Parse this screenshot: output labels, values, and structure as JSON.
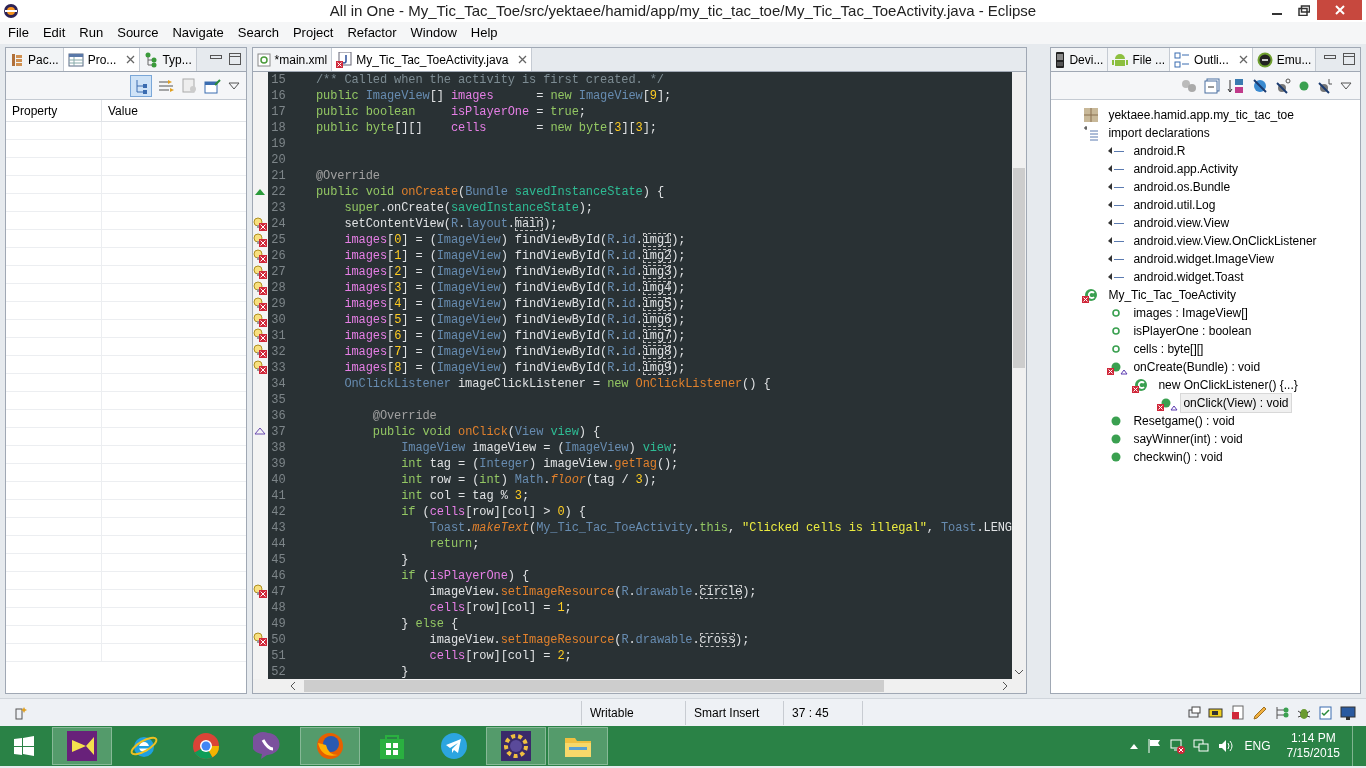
{
  "window": {
    "title": "All in One - My_Tic_Tac_Toe/src/yektaee/hamid/app/my_tic_tac_toe/My_Tic_Tac_ToeActivity.java - Eclipse"
  },
  "menu": [
    "File",
    "Edit",
    "Run",
    "Source",
    "Navigate",
    "Search",
    "Project",
    "Refactor",
    "Window",
    "Help"
  ],
  "left_panel": {
    "tabs": [
      {
        "label": "Pac...",
        "kind": "package",
        "selected": false
      },
      {
        "label": "Pro...",
        "kind": "properties",
        "selected": true
      },
      {
        "label": "Typ...",
        "kind": "hierarchy",
        "selected": false
      }
    ],
    "columns": [
      "Property",
      "Value"
    ]
  },
  "editor": {
    "tabs": [
      {
        "label": "*main.xml",
        "kind": "xml",
        "selected": false
      },
      {
        "label": "My_Tic_Tac_ToeActivity.java",
        "kind": "java",
        "selected": true
      }
    ],
    "lines": [
      {
        "number": "15",
        "kind": "plain",
        "tokens": [
          {
            "kind": "comment",
            "text": "    /** Called when the activity is first created. */"
          }
        ]
      },
      {
        "number": "16",
        "kind": "plain",
        "tokens": [
          {
            "kind": "kw",
            "text": "    public "
          },
          {
            "kind": "type",
            "text": "ImageView"
          },
          {
            "kind": "plain",
            "text": "[] "
          },
          {
            "kind": "field",
            "text": "images"
          },
          {
            "kind": "plain",
            "text": "      = "
          },
          {
            "kind": "kw",
            "text": "new "
          },
          {
            "kind": "type",
            "text": "ImageView"
          },
          {
            "kind": "plain",
            "text": "["
          },
          {
            "kind": "num",
            "text": "9"
          },
          {
            "kind": "plain",
            "text": "];"
          }
        ]
      },
      {
        "number": "17",
        "kind": "plain",
        "tokens": [
          {
            "kind": "kw",
            "text": "    public boolean     "
          },
          {
            "kind": "field",
            "text": "isPlayerOne"
          },
          {
            "kind": "plain",
            "text": " = "
          },
          {
            "kind": "kw",
            "text": "true"
          },
          {
            "kind": "plain",
            "text": ";"
          }
        ]
      },
      {
        "number": "18",
        "kind": "plain",
        "tokens": [
          {
            "kind": "kw",
            "text": "    public byte"
          },
          {
            "kind": "plain",
            "text": "[][]    "
          },
          {
            "kind": "field",
            "text": "cells"
          },
          {
            "kind": "plain",
            "text": "       = "
          },
          {
            "kind": "kw",
            "text": "new byte"
          },
          {
            "kind": "plain",
            "text": "["
          },
          {
            "kind": "num",
            "text": "3"
          },
          {
            "kind": "plain",
            "text": "]["
          },
          {
            "kind": "num",
            "text": "3"
          },
          {
            "kind": "plain",
            "text": "];"
          }
        ]
      },
      {
        "number": "19",
        "kind": "plain"
      },
      {
        "number": "20",
        "kind": "plain"
      },
      {
        "number": "21",
        "kind": "plain",
        "tokens": [
          {
            "kind": "ann",
            "text": "    @Override"
          }
        ]
      },
      {
        "number": "22",
        "kind": "override",
        "tokens": [
          {
            "kind": "kw",
            "text": "    public void "
          },
          {
            "kind": "decl",
            "text": "onCreate"
          },
          {
            "kind": "plain",
            "text": "("
          },
          {
            "kind": "type",
            "text": "Bundle "
          },
          {
            "kind": "param",
            "text": "savedInstanceState"
          },
          {
            "kind": "plain",
            "text": ") {"
          }
        ]
      },
      {
        "number": "23",
        "kind": "plain",
        "tokens": [
          {
            "kind": "kw",
            "text": "        super"
          },
          {
            "kind": "plain",
            "text": ".onCreate("
          },
          {
            "kind": "param",
            "text": "savedInstanceState"
          },
          {
            "kind": "plain",
            "text": ");"
          }
        ]
      },
      {
        "number": "24",
        "kind": "error",
        "tokens": [
          {
            "kind": "plain",
            "text": "        setContentView("
          },
          {
            "kind": "type",
            "text": "R"
          },
          {
            "kind": "plain",
            "text": "."
          },
          {
            "kind": "type",
            "text": "layout"
          },
          {
            "kind": "plain",
            "text": "."
          },
          {
            "kind": "boxed",
            "text": "main"
          },
          {
            "kind": "plain",
            "text": ");"
          }
        ]
      },
      {
        "number": "25",
        "kind": "error",
        "tokens": [
          {
            "kind": "field",
            "text": "        images"
          },
          {
            "kind": "plain",
            "text": "["
          },
          {
            "kind": "num",
            "text": "0"
          },
          {
            "kind": "plain",
            "text": "] = ("
          },
          {
            "kind": "type",
            "text": "ImageView"
          },
          {
            "kind": "plain",
            "text": ") findViewById("
          },
          {
            "kind": "type",
            "text": "R"
          },
          {
            "kind": "plain",
            "text": "."
          },
          {
            "kind": "type",
            "text": "id"
          },
          {
            "kind": "plain",
            "text": "."
          },
          {
            "kind": "boxed",
            "text": "img1"
          },
          {
            "kind": "plain",
            "text": ");"
          }
        ]
      },
      {
        "number": "26",
        "kind": "error",
        "tokens": [
          {
            "kind": "field",
            "text": "        images"
          },
          {
            "kind": "plain",
            "text": "["
          },
          {
            "kind": "num",
            "text": "1"
          },
          {
            "kind": "plain",
            "text": "] = ("
          },
          {
            "kind": "type",
            "text": "ImageView"
          },
          {
            "kind": "plain",
            "text": ") findViewById("
          },
          {
            "kind": "type",
            "text": "R"
          },
          {
            "kind": "plain",
            "text": "."
          },
          {
            "kind": "type",
            "text": "id"
          },
          {
            "kind": "plain",
            "text": "."
          },
          {
            "kind": "boxed",
            "text": "img2"
          },
          {
            "kind": "plain",
            "text": ");"
          }
        ]
      },
      {
        "number": "27",
        "kind": "error",
        "tokens": [
          {
            "kind": "field",
            "text": "        images"
          },
          {
            "kind": "plain",
            "text": "["
          },
          {
            "kind": "num",
            "text": "2"
          },
          {
            "kind": "plain",
            "text": "] = ("
          },
          {
            "kind": "type",
            "text": "ImageView"
          },
          {
            "kind": "plain",
            "text": ") findViewById("
          },
          {
            "kind": "type",
            "text": "R"
          },
          {
            "kind": "plain",
            "text": "."
          },
          {
            "kind": "type",
            "text": "id"
          },
          {
            "kind": "plain",
            "text": "."
          },
          {
            "kind": "boxed",
            "text": "img3"
          },
          {
            "kind": "plain",
            "text": ");"
          }
        ]
      },
      {
        "number": "28",
        "kind": "error",
        "tokens": [
          {
            "kind": "field",
            "text": "        images"
          },
          {
            "kind": "plain",
            "text": "["
          },
          {
            "kind": "num",
            "text": "3"
          },
          {
            "kind": "plain",
            "text": "] = ("
          },
          {
            "kind": "type",
            "text": "ImageView"
          },
          {
            "kind": "plain",
            "text": ") findViewById("
          },
          {
            "kind": "type",
            "text": "R"
          },
          {
            "kind": "plain",
            "text": "."
          },
          {
            "kind": "type",
            "text": "id"
          },
          {
            "kind": "plain",
            "text": "."
          },
          {
            "kind": "boxed",
            "text": "img4"
          },
          {
            "kind": "plain",
            "text": ");"
          }
        ]
      },
      {
        "number": "29",
        "kind": "error",
        "tokens": [
          {
            "kind": "field",
            "text": "        images"
          },
          {
            "kind": "plain",
            "text": "["
          },
          {
            "kind": "num",
            "text": "4"
          },
          {
            "kind": "plain",
            "text": "] = ("
          },
          {
            "kind": "type",
            "text": "ImageView"
          },
          {
            "kind": "plain",
            "text": ") findViewById("
          },
          {
            "kind": "type",
            "text": "R"
          },
          {
            "kind": "plain",
            "text": "."
          },
          {
            "kind": "type",
            "text": "id"
          },
          {
            "kind": "plain",
            "text": "."
          },
          {
            "kind": "boxed",
            "text": "img5"
          },
          {
            "kind": "plain",
            "text": ");"
          }
        ]
      },
      {
        "number": "30",
        "kind": "error",
        "tokens": [
          {
            "kind": "field",
            "text": "        images"
          },
          {
            "kind": "plain",
            "text": "["
          },
          {
            "kind": "num",
            "text": "5"
          },
          {
            "kind": "plain",
            "text": "] = ("
          },
          {
            "kind": "type",
            "text": "ImageView"
          },
          {
            "kind": "plain",
            "text": ") findViewById("
          },
          {
            "kind": "type",
            "text": "R"
          },
          {
            "kind": "plain",
            "text": "."
          },
          {
            "kind": "type",
            "text": "id"
          },
          {
            "kind": "plain",
            "text": "."
          },
          {
            "kind": "boxed",
            "text": "img6"
          },
          {
            "kind": "plain",
            "text": ");"
          }
        ]
      },
      {
        "number": "31",
        "kind": "error",
        "tokens": [
          {
            "kind": "field",
            "text": "        images"
          },
          {
            "kind": "plain",
            "text": "["
          },
          {
            "kind": "num",
            "text": "6"
          },
          {
            "kind": "plain",
            "text": "] = ("
          },
          {
            "kind": "type",
            "text": "ImageView"
          },
          {
            "kind": "plain",
            "text": ") findViewById("
          },
          {
            "kind": "type",
            "text": "R"
          },
          {
            "kind": "plain",
            "text": "."
          },
          {
            "kind": "type",
            "text": "id"
          },
          {
            "kind": "plain",
            "text": "."
          },
          {
            "kind": "boxed",
            "text": "img7"
          },
          {
            "kind": "plain",
            "text": ");"
          }
        ]
      },
      {
        "number": "32",
        "kind": "error",
        "tokens": [
          {
            "kind": "field",
            "text": "        images"
          },
          {
            "kind": "plain",
            "text": "["
          },
          {
            "kind": "num",
            "text": "7"
          },
          {
            "kind": "plain",
            "text": "] = ("
          },
          {
            "kind": "type",
            "text": "ImageView"
          },
          {
            "kind": "plain",
            "text": ") findViewById("
          },
          {
            "kind": "type",
            "text": "R"
          },
          {
            "kind": "plain",
            "text": "."
          },
          {
            "kind": "type",
            "text": "id"
          },
          {
            "kind": "plain",
            "text": "."
          },
          {
            "kind": "boxed",
            "text": "img8"
          },
          {
            "kind": "plain",
            "text": ");"
          }
        ]
      },
      {
        "number": "33",
        "kind": "error",
        "tokens": [
          {
            "kind": "field",
            "text": "        images"
          },
          {
            "kind": "plain",
            "text": "["
          },
          {
            "kind": "num",
            "text": "8"
          },
          {
            "kind": "plain",
            "text": "] = ("
          },
          {
            "kind": "type",
            "text": "ImageView"
          },
          {
            "kind": "plain",
            "text": ") findViewById("
          },
          {
            "kind": "type",
            "text": "R"
          },
          {
            "kind": "plain",
            "text": "."
          },
          {
            "kind": "type",
            "text": "id"
          },
          {
            "kind": "plain",
            "text": "."
          },
          {
            "kind": "boxed",
            "text": "img9"
          },
          {
            "kind": "plain",
            "text": ");"
          }
        ]
      },
      {
        "number": "34",
        "kind": "plain",
        "tokens": [
          {
            "kind": "type",
            "text": "        OnClickListener"
          },
          {
            "kind": "plain",
            "text": " imageClickListener = "
          },
          {
            "kind": "kw",
            "text": "new "
          },
          {
            "kind": "decl",
            "text": "OnClickListener"
          },
          {
            "kind": "plain",
            "text": "() {"
          }
        ]
      },
      {
        "number": "35",
        "kind": "plain"
      },
      {
        "number": "36",
        "kind": "plain",
        "tokens": [
          {
            "kind": "ann",
            "text": "            @Override"
          }
        ]
      },
      {
        "number": "37",
        "kind": "implements",
        "tokens": [
          {
            "kind": "kw",
            "text": "            public void "
          },
          {
            "kind": "decl",
            "text": "onClick"
          },
          {
            "kind": "plain",
            "text": "("
          },
          {
            "kind": "type",
            "text": "View "
          },
          {
            "kind": "param",
            "text": "view"
          },
          {
            "kind": "plain",
            "text": ") {"
          }
        ]
      },
      {
        "number": "38",
        "kind": "plain",
        "tokens": [
          {
            "kind": "type",
            "text": "                ImageView"
          },
          {
            "kind": "plain",
            "text": " imageView = ("
          },
          {
            "kind": "type",
            "text": "ImageView"
          },
          {
            "kind": "plain",
            "text": ") "
          },
          {
            "kind": "param",
            "text": "view"
          },
          {
            "kind": "plain",
            "text": ";"
          }
        ]
      },
      {
        "number": "39",
        "kind": "plain",
        "tokens": [
          {
            "kind": "kw",
            "text": "                int "
          },
          {
            "kind": "plain",
            "text": "tag = ("
          },
          {
            "kind": "type",
            "text": "Integer"
          },
          {
            "kind": "plain",
            "text": ") imageView."
          },
          {
            "kind": "decl",
            "text": "getTag"
          },
          {
            "kind": "plain",
            "text": "();"
          }
        ]
      },
      {
        "number": "40",
        "kind": "plain",
        "tokens": [
          {
            "kind": "kw",
            "text": "                int "
          },
          {
            "kind": "plain",
            "text": "row = ("
          },
          {
            "kind": "kw",
            "text": "int"
          },
          {
            "kind": "plain",
            "text": ") "
          },
          {
            "kind": "type",
            "text": "Math"
          },
          {
            "kind": "plain",
            "text": "."
          },
          {
            "kind": "italic",
            "text": "floor"
          },
          {
            "kind": "plain",
            "text": "(tag / "
          },
          {
            "kind": "num",
            "text": "3"
          },
          {
            "kind": "plain",
            "text": ");"
          }
        ]
      },
      {
        "number": "41",
        "kind": "plain",
        "tokens": [
          {
            "kind": "kw",
            "text": "                int "
          },
          {
            "kind": "plain",
            "text": "col = tag % "
          },
          {
            "kind": "num",
            "text": "3"
          },
          {
            "kind": "plain",
            "text": ";"
          }
        ]
      },
      {
        "number": "42",
        "kind": "plain",
        "tokens": [
          {
            "kind": "kw",
            "text": "                if "
          },
          {
            "kind": "plain",
            "text": "("
          },
          {
            "kind": "field",
            "text": "cells"
          },
          {
            "kind": "plain",
            "text": "[row][col] > "
          },
          {
            "kind": "num",
            "text": "0"
          },
          {
            "kind": "plain",
            "text": ") {"
          }
        ]
      },
      {
        "number": "43",
        "kind": "plain",
        "tokens": [
          {
            "kind": "type",
            "text": "                    Toast"
          },
          {
            "kind": "plain",
            "text": "."
          },
          {
            "kind": "italic",
            "text": "makeText"
          },
          {
            "kind": "plain",
            "text": "("
          },
          {
            "kind": "type",
            "text": "My_Tic_Tac_ToeActivity"
          },
          {
            "kind": "plain",
            "text": "."
          },
          {
            "kind": "kw",
            "text": "this"
          },
          {
            "kind": "plain",
            "text": ", "
          },
          {
            "kind": "str",
            "text": "\"Clicked cells is illegal\""
          },
          {
            "kind": "plain",
            "text": ", "
          },
          {
            "kind": "type",
            "text": "Toast"
          },
          {
            "kind": "plain",
            "text": ".LENG"
          }
        ]
      },
      {
        "number": "44",
        "kind": "plain",
        "tokens": [
          {
            "kind": "kw",
            "text": "                    return"
          },
          {
            "kind": "plain",
            "text": ";"
          }
        ]
      },
      {
        "number": "45",
        "kind": "plain",
        "tokens": [
          {
            "kind": "plain",
            "text": "                }"
          }
        ]
      },
      {
        "number": "46",
        "kind": "plain",
        "tokens": [
          {
            "kind": "kw",
            "text": "                if "
          },
          {
            "kind": "plain",
            "text": "("
          },
          {
            "kind": "field",
            "text": "isPlayerOne"
          },
          {
            "kind": "plain",
            "text": ") {"
          }
        ]
      },
      {
        "number": "47",
        "kind": "error",
        "tokens": [
          {
            "kind": "plain",
            "text": "                    imageView."
          },
          {
            "kind": "decl",
            "text": "setImageResource"
          },
          {
            "kind": "plain",
            "text": "("
          },
          {
            "kind": "type",
            "text": "R"
          },
          {
            "kind": "plain",
            "text": "."
          },
          {
            "kind": "type",
            "text": "drawable"
          },
          {
            "kind": "plain",
            "text": "."
          },
          {
            "kind": "boxed",
            "text": "circle"
          },
          {
            "kind": "plain",
            "text": ");"
          }
        ]
      },
      {
        "number": "48",
        "kind": "plain",
        "tokens": [
          {
            "kind": "field",
            "text": "                    cells"
          },
          {
            "kind": "plain",
            "text": "[row][col] = "
          },
          {
            "kind": "num",
            "text": "1"
          },
          {
            "kind": "plain",
            "text": ";"
          }
        ]
      },
      {
        "number": "49",
        "kind": "plain",
        "tokens": [
          {
            "kind": "plain",
            "text": "                } "
          },
          {
            "kind": "kw",
            "text": "else "
          },
          {
            "kind": "plain",
            "text": "{"
          }
        ]
      },
      {
        "number": "50",
        "kind": "error",
        "tokens": [
          {
            "kind": "plain",
            "text": "                    imageView."
          },
          {
            "kind": "decl",
            "text": "setImageResource"
          },
          {
            "kind": "plain",
            "text": "("
          },
          {
            "kind": "type",
            "text": "R"
          },
          {
            "kind": "plain",
            "text": "."
          },
          {
            "kind": "type",
            "text": "drawable"
          },
          {
            "kind": "plain",
            "text": "."
          },
          {
            "kind": "boxed",
            "text": "cross"
          },
          {
            "kind": "plain",
            "text": ");"
          }
        ]
      },
      {
        "number": "51",
        "kind": "plain",
        "tokens": [
          {
            "kind": "field",
            "text": "                    cells"
          },
          {
            "kind": "plain",
            "text": "[row][col] = "
          },
          {
            "kind": "num",
            "text": "2"
          },
          {
            "kind": "plain",
            "text": ";"
          }
        ]
      },
      {
        "number": "52",
        "kind": "plain",
        "tokens": [
          {
            "kind": "plain",
            "text": "                }"
          }
        ]
      }
    ]
  },
  "right_panel": {
    "tabs": [
      {
        "label": "Devi...",
        "kind": "phone",
        "selected": false
      },
      {
        "label": "File ...",
        "kind": "android",
        "selected": false
      },
      {
        "label": "Outli...",
        "kind": "outline",
        "selected": true
      },
      {
        "label": "Emu...",
        "kind": "emulator",
        "selected": false
      }
    ],
    "outline": [
      {
        "label": "yektaee.hamid.app.my_tic_tac_toe",
        "kind": "package",
        "error": false,
        "override": false,
        "selected": false
      },
      {
        "label": "import declarations",
        "kind": "imports",
        "error": false,
        "override": false,
        "selected": false,
        "children": [
          {
            "label": "android.R",
            "kind": "import",
            "error": false,
            "override": false,
            "selected": false
          },
          {
            "label": "android.app.Activity",
            "kind": "import",
            "error": false,
            "override": false,
            "selected": false
          },
          {
            "label": "android.os.Bundle",
            "kind": "import",
            "error": false,
            "override": false,
            "selected": false
          },
          {
            "label": "android.util.Log",
            "kind": "import",
            "error": false,
            "override": false,
            "selected": false
          },
          {
            "label": "android.view.View",
            "kind": "import",
            "error": false,
            "override": false,
            "selected": false
          },
          {
            "label": "android.view.View.OnClickListener",
            "kind": "import",
            "error": false,
            "override": false,
            "selected": false
          },
          {
            "label": "android.widget.ImageView",
            "kind": "import",
            "error": false,
            "override": false,
            "selected": false
          },
          {
            "label": "android.widget.Toast",
            "kind": "import",
            "error": false,
            "override": false,
            "selected": false
          }
        ]
      },
      {
        "label": "My_Tic_Tac_ToeActivity",
        "kind": "class",
        "error": true,
        "override": false,
        "selected": false,
        "children": [
          {
            "label": "images : ImageView[]",
            "kind": "field",
            "error": false,
            "override": false,
            "selected": false
          },
          {
            "label": "isPlayerOne : boolean",
            "kind": "field",
            "error": false,
            "override": false,
            "selected": false
          },
          {
            "label": "cells : byte[][]",
            "kind": "field",
            "error": false,
            "override": false,
            "selected": false
          },
          {
            "label": "onCreate(Bundle) : void",
            "kind": "method",
            "error": true,
            "override": true,
            "selected": false,
            "children": [
              {
                "label": "new OnClickListener() {...}",
                "kind": "class",
                "error": true,
                "override": false,
                "selected": false,
                "children": [
                  {
                    "label": "onClick(View) : void",
                    "kind": "method",
                    "error": true,
                    "override": true,
                    "selected": true
                  }
                ]
              }
            ]
          },
          {
            "label": "Resetgame() : void",
            "kind": "method",
            "error": false,
            "override": false,
            "selected": false
          },
          {
            "label": "sayWinner(int) : void",
            "kind": "method",
            "error": false,
            "override": false,
            "selected": false
          },
          {
            "label": "checkwin() : void",
            "kind": "method",
            "error": false,
            "override": false,
            "selected": false
          }
        ]
      }
    ]
  },
  "status_bar": [
    "Writable",
    "Smart Insert",
    "37 : 45"
  ],
  "taskbar": {
    "apps": [
      {
        "kind": "visualstudio",
        "running": true
      },
      {
        "kind": "ie",
        "running": false
      },
      {
        "kind": "chrome",
        "running": false
      },
      {
        "kind": "viber",
        "running": false
      },
      {
        "kind": "firefox",
        "running": true
      },
      {
        "kind": "store",
        "running": false
      },
      {
        "kind": "telegram",
        "running": false
      },
      {
        "kind": "eclipse",
        "running": true
      },
      {
        "kind": "explorer",
        "running": true
      }
    ],
    "language": "ENG",
    "time": "1:14 PM",
    "date": "7/15/2015"
  }
}
